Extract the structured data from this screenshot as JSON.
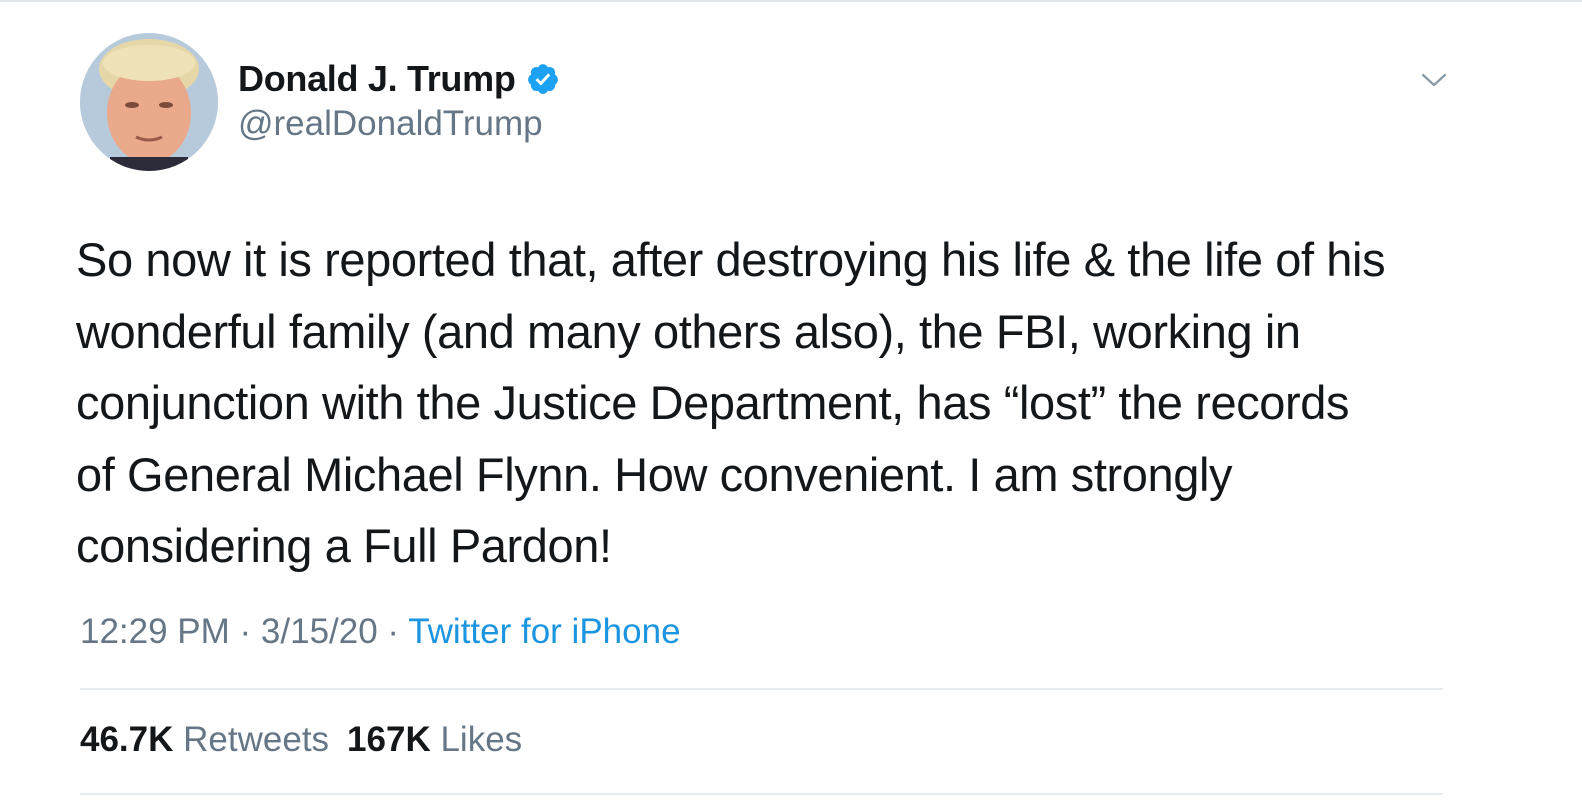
{
  "author": {
    "display_name": "Donald J. Trump",
    "handle": "@realDonaldTrump",
    "verified": true,
    "verified_icon": "verified-badge-icon"
  },
  "menu_icon": "chevron-down-icon",
  "tweet": {
    "text": "So now it is reported that, after destroying his life & the life of his\nwonderful family (and many others also), the FBI, working in\nconjunction with the Justice Department, has “lost” the records\nof General Michael Flynn. How convenient. I am strongly\nconsidering a Full Pardon!"
  },
  "meta": {
    "time": "12:29 PM",
    "date": "3/15/20",
    "separator": " · ",
    "source": "Twitter for iPhone"
  },
  "stats": {
    "retweets_count": "46.7K",
    "retweets_label": "Retweets",
    "likes_count": "167K",
    "likes_label": "Likes"
  },
  "colors": {
    "text_primary": "#14171a",
    "text_secondary": "#657786",
    "link": "#1b95e0",
    "verified": "#1da1f2",
    "divider": "#e6ecf0"
  }
}
